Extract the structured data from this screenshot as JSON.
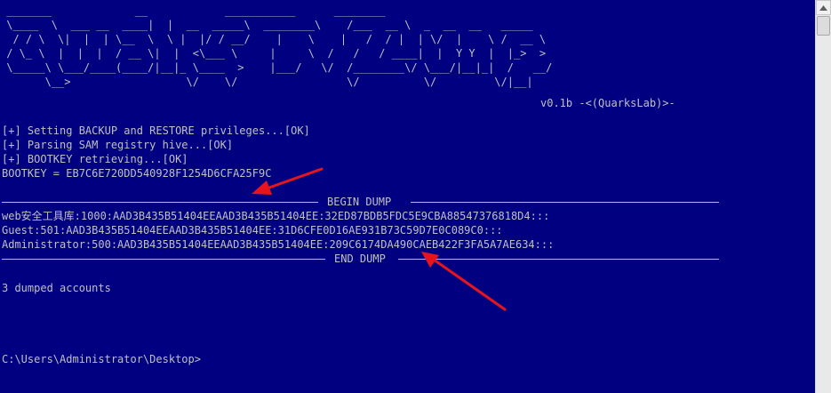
{
  "banner": {
    "ascii_art": " _______             __            ___________      ________\n \\____  \\  ___ __  ____|  |  __  _____\\  ________\\    /___  __ \\  _  __  __   _____\n  / / \\  \\|  |  | \\__  \\  \\ |  |/ / __/    |    \\    |   /  / |  | \\/  |    \\ /  __ \\\n / \\_ \\  |  |  |  / __ \\|  |  <\\___ \\     |     \\  /   /   / ____|  |  Y Y  |  |_>  >\n \\_____\\ \\___/____(____/|__|_ \\____  >    |___/   \\/  /________\\/ \\___/|__|_|  /   __/\n       \\__>                  \\/    \\/                 \\/          \\/         \\/|__|",
    "version": "v0.1b -<(QuarksLab)>-"
  },
  "output": {
    "lines": [
      "[+] Setting BACKUP and RESTORE privileges...[OK]",
      "[+] Parsing SAM registry hive...[OK]",
      "[+] BOOTKEY retrieving...[OK]",
      "BOOTKEY = EB7C6E720DD540928F1254D6CFA25F9C"
    ],
    "begin_dump_label": "BEGIN DUMP",
    "accounts": [
      "web安全工具库:1000:AAD3B435B51404EEAAD3B435B51404EE:32ED87BDB5FDC5E9CBA88547376818D4:::",
      "Guest:501:AAD3B435B51404EEAAD3B435B51404EE:31D6CFE0D16AE931B73C59D7E0C089C0:::",
      "Administrator:500:AAD3B435B51404EEAAD3B435B51404EE:209C6174DA490CAEB422F3FA5A7AE634:::"
    ],
    "end_dump_label": "END DUMP",
    "summary": "3 dumped accounts",
    "prompt": "C:\\Users\\Administrator\\Desktop>"
  },
  "colors": {
    "background": "#000080",
    "text": "#c0c0c0",
    "annotation_arrow": "#e8141c"
  },
  "scrollbar": {
    "up_icon": "triangle-up-icon"
  }
}
